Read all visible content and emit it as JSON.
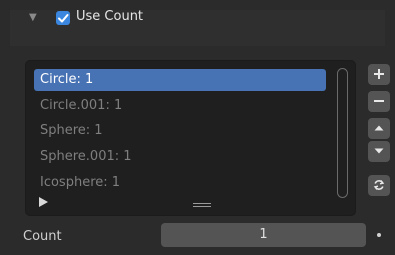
{
  "panel": {
    "title": "Use Count",
    "checked": true
  },
  "list": {
    "items": [
      {
        "label": "Circle: 1",
        "selected": true
      },
      {
        "label": "Circle.001: 1",
        "selected": false
      },
      {
        "label": "Sphere: 1",
        "selected": false
      },
      {
        "label": "Sphere.001: 1",
        "selected": false
      },
      {
        "label": "Icosphere: 1",
        "selected": false
      }
    ]
  },
  "side_buttons": [
    "plus-icon",
    "minus-icon",
    "move-up-icon",
    "move-down-icon",
    "refresh-icon"
  ],
  "count": {
    "label": "Count",
    "value": "1"
  },
  "colors": {
    "accent": "#4772b3",
    "checkbox": "#3b87e0",
    "background": "#2b2b2b"
  }
}
